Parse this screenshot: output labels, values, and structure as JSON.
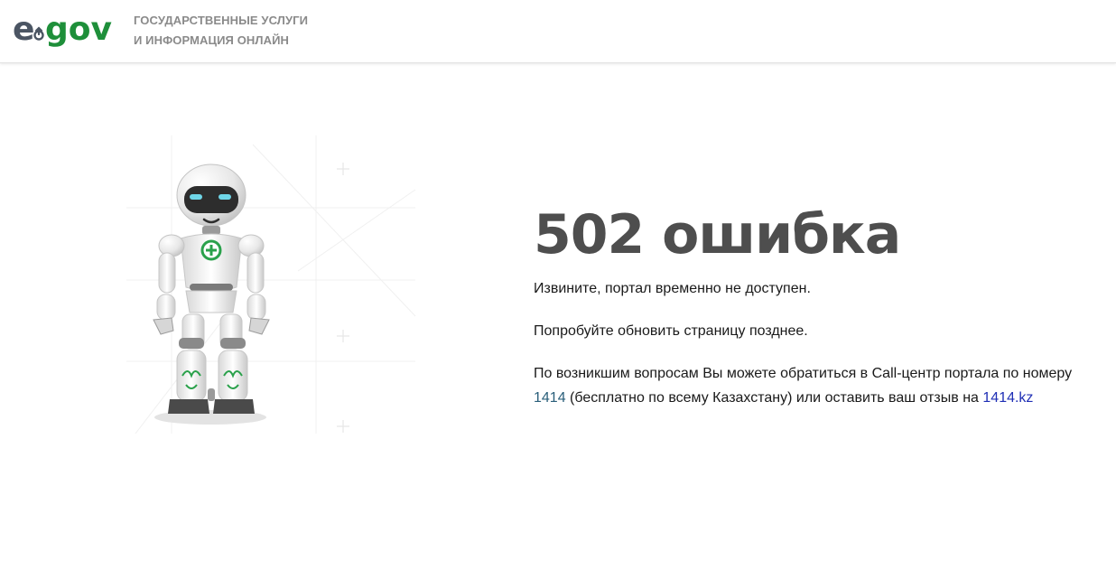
{
  "header": {
    "logo_text": "e-gov",
    "tagline_line1": "Государственные услуги",
    "tagline_line2": "и информация онлайн"
  },
  "error": {
    "title": "502 ошибка",
    "line1": "Извините, портал временно не доступен.",
    "line2": "Попробуйте обновить страницу позднее.",
    "contact_before": "По возникшим вопросам Вы можете обратиться в Call-центр портала по номеру ",
    "phone": "1414",
    "contact_middle": " (бесплатно по всему Казахстану) или оставить ваш отзыв на ",
    "site": "1414.kz"
  },
  "colors": {
    "brand_dark": "#4b5563",
    "brand_green": "#1e8f3a",
    "title": "#4e4e4e",
    "phone_link": "#2a5f7a",
    "site_link": "#1f2fb5"
  },
  "illustration": {
    "icon": "robot-icon"
  }
}
